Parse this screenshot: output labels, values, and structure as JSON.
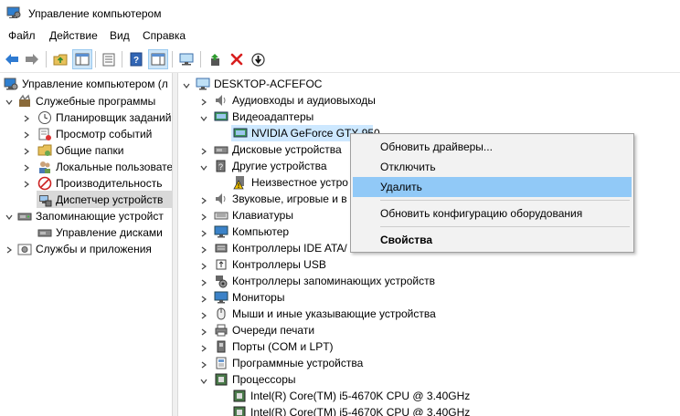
{
  "window": {
    "title": "Управление компьютером"
  },
  "menu": [
    "Файл",
    "Действие",
    "Вид",
    "Справка"
  ],
  "left_tree": {
    "root": "Управление компьютером (л",
    "services": "Служебные программы",
    "scheduler": "Планировщик заданий",
    "events": "Просмотр событий",
    "shared": "Общие папки",
    "users": "Локальные пользовате",
    "perf": "Производительность",
    "devmgr": "Диспетчер устройств",
    "storage": "Запоминающие устройст",
    "disks": "Управление дисками",
    "apps": "Службы и приложения"
  },
  "right_tree": {
    "computer": "DESKTOP-ACFEFOC",
    "audio": "Аудиовходы и аудиовыходы",
    "video": "Видеоадаптеры",
    "gpu": "NVIDIA GeForce GTX 950",
    "disk": "Дисковые устройства",
    "other": "Другие устройства",
    "unknown": "Неизвестное устро",
    "sound": "Звуковые, игровые и в",
    "keyboards": "Клавиатуры",
    "pc": "Компьютер",
    "ide": "Контроллеры IDE ATA/",
    "usb": "Контроллеры USB",
    "storctl": "Контроллеры запоминающих устройств",
    "monitors": "Мониторы",
    "mice": "Мыши и иные указывающие устройства",
    "print": "Очереди печати",
    "ports": "Порты (COM и LPT)",
    "software": "Программные устройства",
    "cpus": "Процессоры",
    "cpu1": "Intel(R) Core(TM) i5-4670K CPU @ 3.40GHz",
    "cpu2": "Intel(R) Core(TM) i5-4670K CPU @ 3.40GHz"
  },
  "context_menu": {
    "update_driver": "Обновить драйверы...",
    "disable": "Отключить",
    "uninstall": "Удалить",
    "scan": "Обновить конфигурацию оборудования",
    "properties": "Свойства"
  },
  "colors": {
    "selection": "#91c9f7",
    "pressed": "#cce4f7",
    "accent": "#1e78d7"
  }
}
